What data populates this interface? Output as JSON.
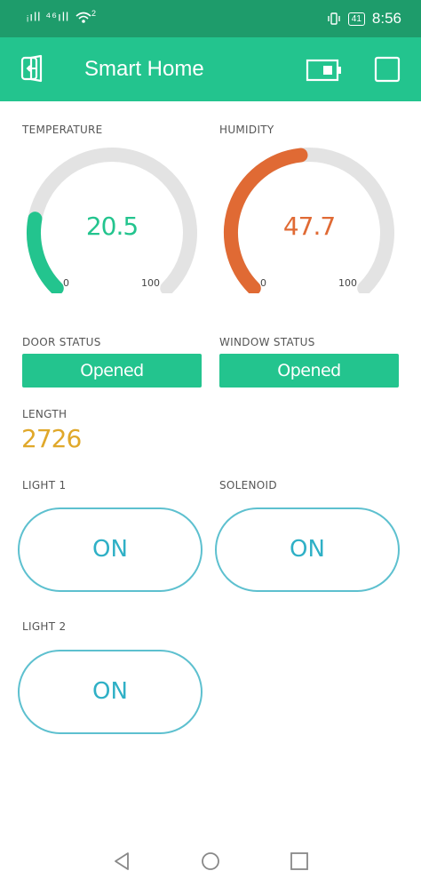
{
  "status_bar": {
    "signal": "ᵢıll ⁴⁶ıll",
    "wifi_badge": "2",
    "battery": "41",
    "time": "8:56"
  },
  "app_bar": {
    "title": "Smart Home",
    "icons": [
      "back-door-icon",
      "device-icon",
      "square-icon"
    ]
  },
  "gauges": {
    "temperature": {
      "label": "TEMPERATURE",
      "value": "20.5",
      "min": "0",
      "max": "100",
      "level": 0.205,
      "color": "#23c48e"
    },
    "humidity": {
      "label": "HUMIDITY",
      "value": "47.7",
      "min": "0",
      "max": "100",
      "level": 0.477,
      "color": "#e06a34"
    }
  },
  "door": {
    "label": "DOOR STATUS",
    "value": "Opened"
  },
  "window": {
    "label": "WINDOW STATUS",
    "value": "Opened"
  },
  "length": {
    "label": "LENGTH",
    "value": "2726",
    "color": "#e0a82a"
  },
  "buttons": {
    "light1": {
      "label": "LIGHT 1",
      "state": "ON"
    },
    "solenoid": {
      "label": "SOLENOID",
      "state": "ON"
    },
    "light2": {
      "label": "LIGHT 2",
      "state": "ON"
    }
  },
  "colors": {
    "status_bar": "#1e9c6b",
    "app_bar": "#23c48e",
    "accent_green": "#23c48e",
    "toggle_border": "#5dc0cf",
    "toggle_text": "#2fb0c6",
    "gauge_track": "#e3e3e3"
  },
  "nav_bar": {
    "icons": [
      "back-triangle-icon",
      "home-circle-icon",
      "recents-square-icon"
    ]
  }
}
